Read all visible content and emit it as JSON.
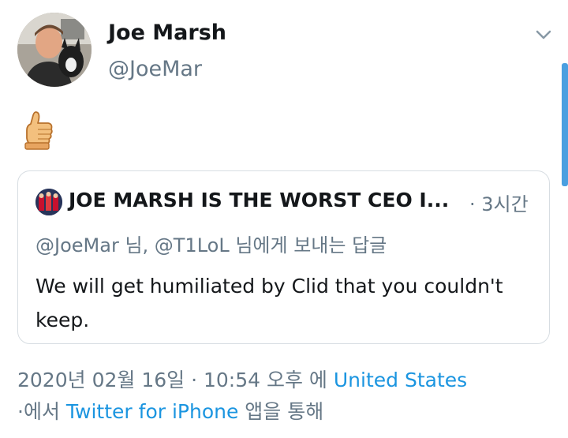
{
  "tweet": {
    "author_name": "Joe Marsh",
    "author_handle": "@JoeMar",
    "body_emoji": "thumbs-up"
  },
  "quoted": {
    "author_name": "JOE MARSH IS THE WORST CEO I...",
    "time": "· 3시간",
    "reply_to": "@JoeMar 님, @T1LoL 님에게 보내는 답글",
    "text": "We will get humiliated by Clid that you couldn't keep."
  },
  "meta": {
    "date_time": "2020년 02월 16일 · 10:54 오후 에 ",
    "location": "United States",
    "from_prefix": "·에서 ",
    "source": "Twitter for iPhone",
    "via_suffix": " 앱을 통해"
  },
  "colors": {
    "link": "#1b95e0",
    "secondary_text": "#657786",
    "border": "#d7dde2",
    "scrollbar": "#4a9fe0"
  },
  "icons": {
    "menu": "chevron-down-icon",
    "emoji": "thumbs-up-icon"
  }
}
